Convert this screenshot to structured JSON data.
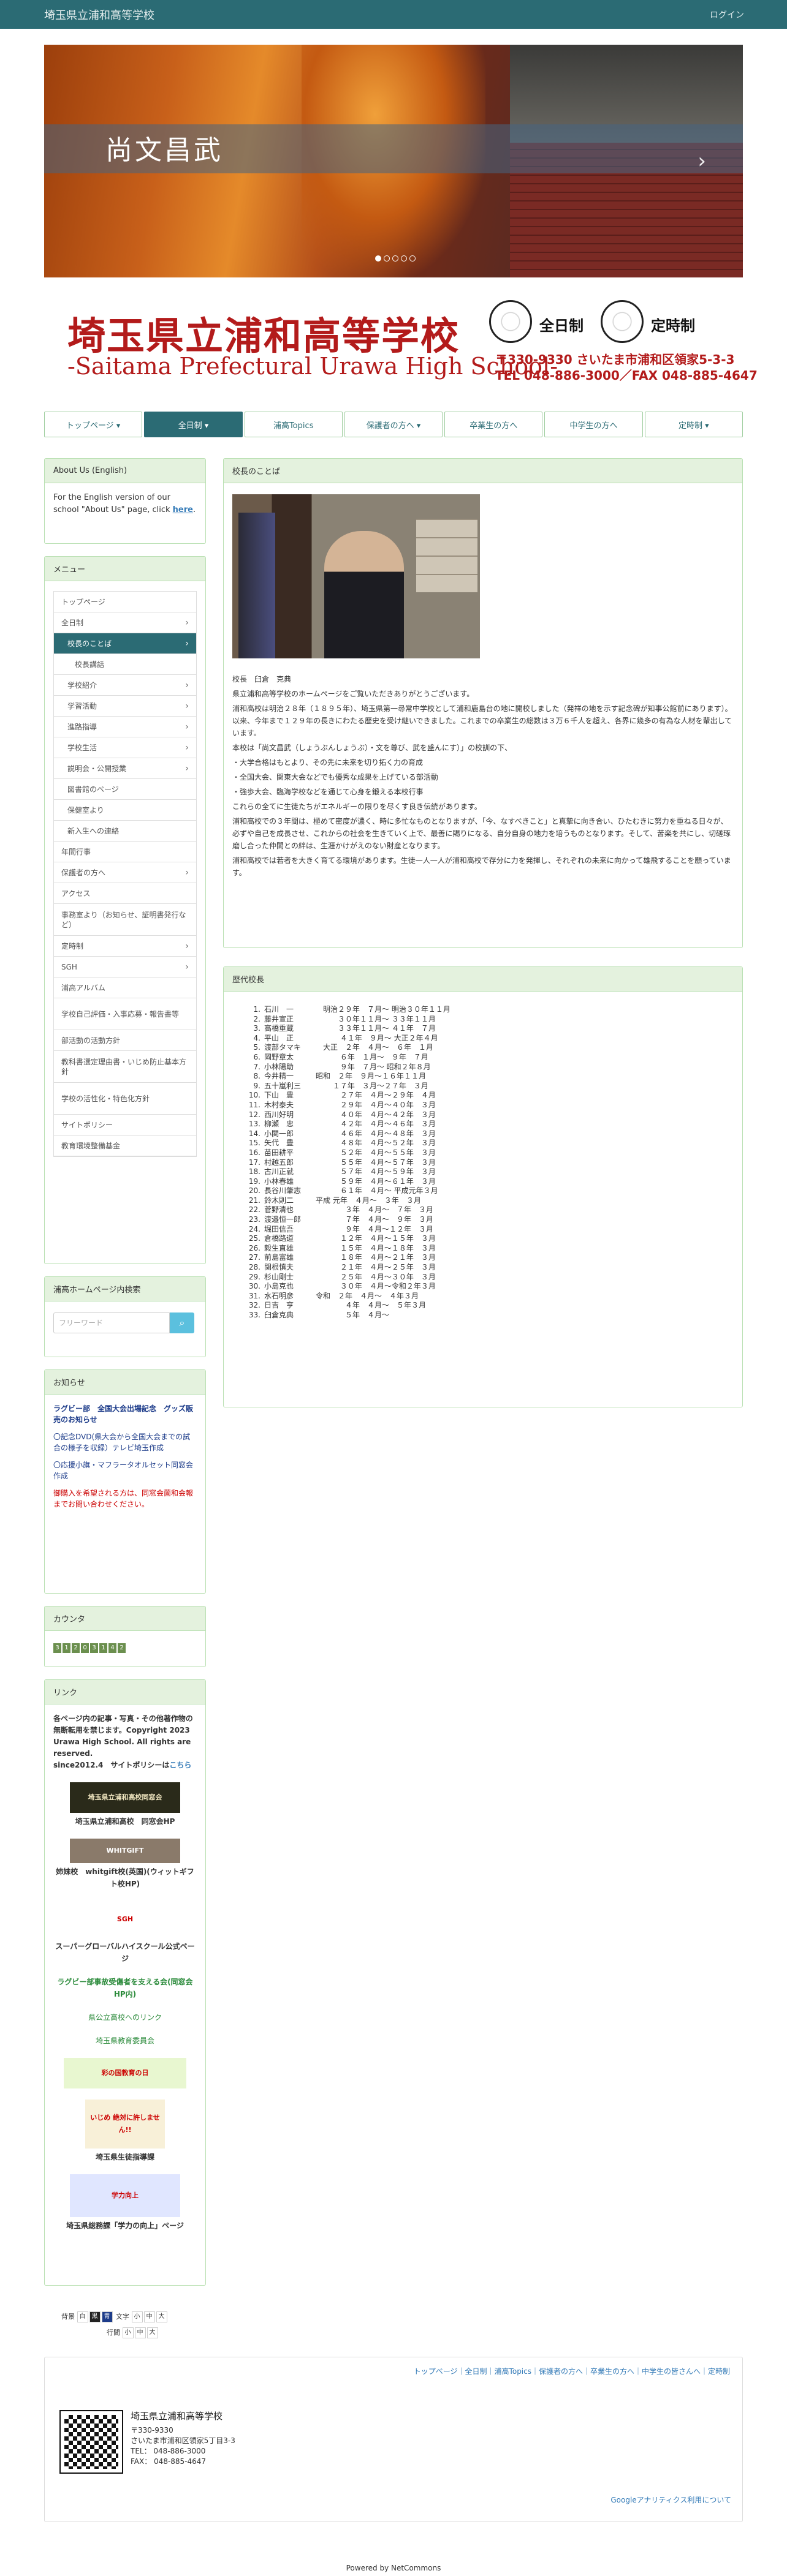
{
  "header": {
    "site_name": "埼玉県立浦和高等学校",
    "login": "ログイン"
  },
  "slider": {
    "caption": "尚文昌武",
    "next": "›",
    "dots": 5
  },
  "banner": {
    "title_jp": "埼玉県立浦和高等学校",
    "title_en": "-Saitama Prefectural Urawa High School-",
    "seal1": "全日制",
    "seal2": "定時制",
    "address": "〒330-9330 さいたま市浦和区領家5-3-3",
    "tel": "TEL 048-886-3000／FAX 048-885-4647"
  },
  "nav": [
    {
      "label": "トップページ ▾",
      "active": false
    },
    {
      "label": "全日制 ▾",
      "active": true
    },
    {
      "label": "浦高Topics",
      "active": false
    },
    {
      "label": "保護者の方へ ▾",
      "active": false
    },
    {
      "label": "卒業生の方へ",
      "active": false
    },
    {
      "label": "中学生の方へ",
      "active": false
    },
    {
      "label": "定時制 ▾",
      "active": false
    }
  ],
  "about": {
    "title": "About Us (English)",
    "text": "For the English version of our school \"About Us\" page, click ",
    "link": "here",
    "dot": "."
  },
  "menu": {
    "title": "メニュー",
    "items": [
      {
        "label": "トップページ",
        "level": 0,
        "chev": false,
        "active": false
      },
      {
        "label": "全日制",
        "level": 0,
        "chev": true,
        "active": false
      },
      {
        "label": "校長のことば",
        "level": 1,
        "chev": true,
        "active": true
      },
      {
        "label": "校長講話",
        "level": 2,
        "chev": false,
        "active": false
      },
      {
        "label": "学校紹介",
        "level": 1,
        "chev": true,
        "active": false
      },
      {
        "label": "学習活動",
        "level": 1,
        "chev": true,
        "active": false
      },
      {
        "label": "進路指導",
        "level": 1,
        "chev": true,
        "active": false
      },
      {
        "label": "学校生活",
        "level": 1,
        "chev": true,
        "active": false
      },
      {
        "label": "説明会・公開授業",
        "level": 1,
        "chev": true,
        "active": false
      },
      {
        "label": "図書館のページ",
        "level": 1,
        "chev": false,
        "active": false
      },
      {
        "label": "保健室より",
        "level": 1,
        "chev": false,
        "active": false
      },
      {
        "label": "新入生への連絡",
        "level": 1,
        "chev": false,
        "active": false
      },
      {
        "label": "年間行事",
        "level": 0,
        "chev": false,
        "active": false
      },
      {
        "label": "保護者の方へ",
        "level": 0,
        "chev": true,
        "active": false
      },
      {
        "label": "アクセス",
        "level": 0,
        "chev": false,
        "active": false
      },
      {
        "label": "事務室より（お知らせ、証明書発行など）",
        "level": 0,
        "chev": false,
        "active": false,
        "tall": true
      },
      {
        "label": "定時制",
        "level": 0,
        "chev": true,
        "active": false
      },
      {
        "label": "SGH",
        "level": 0,
        "chev": true,
        "active": false
      },
      {
        "label": "浦高アルバム",
        "level": 0,
        "chev": false,
        "active": false
      },
      {
        "label": "学校自己評価・入事応募・報告書等",
        "level": 0,
        "chev": false,
        "active": false,
        "tall": true
      },
      {
        "label": "部活動の活動方針",
        "level": 0,
        "chev": false,
        "active": false
      },
      {
        "label": "教科書選定理由書・いじめ防止基本方針",
        "level": 0,
        "chev": false,
        "active": false,
        "tall": true
      },
      {
        "label": "学校の活性化・特色化方針",
        "level": 0,
        "chev": false,
        "active": false,
        "tall": true
      },
      {
        "label": "サイトポリシー",
        "level": 0,
        "chev": false,
        "active": false
      },
      {
        "label": "教育環境整備基金",
        "level": 0,
        "chev": false,
        "active": false
      }
    ]
  },
  "search": {
    "title": "浦高ホームページ内検索",
    "placeholder": "フリーワード",
    "icon": "⌕"
  },
  "news": {
    "title": "お知らせ",
    "items": [
      {
        "text": "ラグビー部　全国大会出場記念　グッズ販売のお知らせ",
        "style": "blue-bold"
      },
      {
        "text": "〇記念DVD(県大会から全国大会までの試合の様子を収録）テレビ埼玉作成",
        "style": "blue"
      },
      {
        "text": "〇応援小旗・マフラータオルセット同窓会作成",
        "style": "blue"
      },
      {
        "text": "御購入を希望される方は、同窓会薗和会報までお問い合わせください。",
        "style": "red"
      }
    ]
  },
  "counter": {
    "title": "カウンタ",
    "digits": [
      "3",
      "1",
      "2",
      "0",
      "3",
      "1",
      "4",
      "2"
    ]
  },
  "links": {
    "title": "リンク",
    "copyright": "各ページ内の記事・写真・その他著作物の無断転用を禁じます。Copyright 2023 Urawa High School. All rights are reserved.",
    "since": "since2012.4　サイトポリシーは",
    "since_link": "こちら",
    "items": [
      {
        "img": "埼玉県立浦和高校同窓会",
        "label": "埼玉県立浦和高校　同窓会HP"
      },
      {
        "img": "WHITGIFT",
        "label": "姉妹校　whitgift校(英国)(ウィットギフト校HP)"
      },
      {
        "img": "SGH",
        "label": "スーパーグローバルハイスクール公式ページ"
      },
      {
        "img": "",
        "label": "ラグビー部事故受傷者を支える会(同窓会HP内)"
      },
      {
        "img": "",
        "label": "県公立高校へのリンク"
      },
      {
        "img": "",
        "label": "埼玉県教育委員会"
      },
      {
        "img": "彩の国教育の日",
        "label": ""
      },
      {
        "img": "いじめ 絶対に許しません!!",
        "label": "埼玉県生徒指導課"
      },
      {
        "img": "学力向上",
        "label": "埼玉県総務課「学力の向上」ページ"
      }
    ]
  },
  "principal": {
    "title": "校長のことば",
    "name": "校長　臼倉　克典",
    "paragraphs": [
      "県立浦和高等学校のホームページをご覧いただきありがとうございます。",
      "浦和高校は明治２８年（１８９５年）、埼玉県第一尋常中学校として浦和鹿島台の地に開校しました（発祥の地を示す記念碑が知事公館前にあります）。以来、今年まで１２９年の長きにわたる歴史を受け継いできました。これまでの卒業生の総数は３万６千人を超え、各界に幾多の有為な人材を輩出しています。",
      "本校は「尚文昌武（しょうぶんしょうぶ）・文を尊び、武を盛んにす）」の校訓の下、",
      "・大学合格はもとより、その先に未来を切り拓く力の育成",
      "・全国大会、関東大会などでも優秀な成果を上げている部活動",
      "・強歩大会、臨海学校などを通じて心身を鍛える本校行事",
      "これらの全てに生徒たちがエネルギーの限りを尽くす良き伝統があります。",
      "浦和高校での３年間は、極めて密度が濃く、時に多忙なものとなりますが、「今、なすべきこと」と真摯に向き合い、ひたむきに努力を重ねる日々が、必ずや自己を成長させ、これからの社会を生きていく上で、最善に賜りになる、自分自身の地力を培うものとなります。そして、苦楽を共にし、切磋琢磨し合った仲間との絆は、生涯かけがえのない財産となります。",
      "浦和高校では若者を大きく育てる環境があります。生徒一人一人が浦和高校で存分に力を発揮し、それぞれの未来に向かって雄飛することを願っています。"
    ]
  },
  "history": {
    "title": "歴代校長",
    "rows": [
      [
        "1.",
        "石川　一　　　　明治２９年　７月～ 明治３０年１１月"
      ],
      [
        "2.",
        "藤井宣正　　　　　　３０年１１月～ ３３年１１月"
      ],
      [
        "3.",
        "高橋重蔵　　　　　　３３年１１月～ ４１年　７月"
      ],
      [
        "4.",
        "平山　正　　　　　　 ４１年　９月～ 大正２年４月"
      ],
      [
        "5.",
        "渡部タマキ　　　大正　２年　４月～　６年　１月"
      ],
      [
        "6.",
        "岡野章太　　　　　　 ６年　１月～　９年　７月"
      ],
      [
        "7.",
        "小林陽助　　　　　　 ９年　７月～ 昭和２年８月"
      ],
      [
        "8.",
        "今井精一　　　昭和　２年　９月～１６年１１月"
      ],
      [
        "9.",
        "五十嵐利三　　　　 １７年　３月～２７年　３月"
      ],
      [
        "10.",
        "下山　豊　　　　　　 ２７年　４月～２９年　４月"
      ],
      [
        "11.",
        "木村泰夫　　　　　　 ２９年　４月～４０年　３月"
      ],
      [
        "12.",
        "西川好明　　　　　　 ４０年　４月～４２年　３月"
      ],
      [
        "13.",
        "柳瀬　忠　　　　　　 ４２年　４月～４６年　３月"
      ],
      [
        "14.",
        "小関一郎　　　　　　 ４６年　４月～４８年　３月"
      ],
      [
        "15.",
        "矢代　豊　　　　　　 ４８年　４月～５２年　３月"
      ],
      [
        "16.",
        "苗田耕平　　　　　　 ５２年　４月～５５年　３月"
      ],
      [
        "17.",
        "村越五郎　　　　　　 ５５年　４月～５７年　３月"
      ],
      [
        "18.",
        "古川正就　　　　　　 ５７年　４月～５９年　３月"
      ],
      [
        "19.",
        "小林春雄　　　　　　 ５９年　４月～６１年　３月"
      ],
      [
        "20.",
        "長谷川肇志　　　　　 ６１年　４月～ 平成元年３月"
      ],
      [
        "21.",
        "鈴木則二　　　平成 元年　４月～　３年　３月"
      ],
      [
        "22.",
        "菅野清也　　　　　　　３年　４月～　７年　３月"
      ],
      [
        "23.",
        "渡邉恒一郎　　　　　　７年　４月～　９年　３月"
      ],
      [
        "24.",
        "堀田信吾　　　　　　　９年　４月～１２年　３月"
      ],
      [
        "25.",
        "倉橋路道　　　　　　 １２年　４月～１５年　３月"
      ],
      [
        "26.",
        "毅生直雄　　　　　　 １５年　４月～１８年　３月"
      ],
      [
        "27.",
        "前島富雄　　　　　　 １８年　４月～２１年　３月"
      ],
      [
        "28.",
        "関根慎夫　　　　　　 ２１年　４月～２５年　３月"
      ],
      [
        "29.",
        "杉山剛士　　　　　　 ２５年　４月～３０年　３月"
      ],
      [
        "30.",
        "小島克也　　　　　　 ３０年　４月～令和２年３月"
      ],
      [
        "31.",
        "水石明彦　　　令和　２年　４月～　４年３月"
      ],
      [
        "32.",
        "日吉　亨　　　　　　　４年　４月～　５年３月"
      ],
      [
        "33.",
        "臼倉克典　　　　　　　５年　４月～"
      ]
    ]
  },
  "font_controls": {
    "bg_label": "背景",
    "bg_opts": [
      "白",
      "黒",
      "青"
    ],
    "text_label": "文字",
    "text_opts": [
      "小",
      "中",
      "大"
    ],
    "line_label": "行間",
    "line_opts": [
      "小",
      "中",
      "大"
    ]
  },
  "footer": {
    "nav": "トップページ｜全日制｜浦高Topics｜保護者の方へ｜卒業生の方へ｜中学生の皆さんへ｜定時制",
    "name": "埼玉県立浦和高等学校",
    "postal": "〒330-9330",
    "address": "さいたま市浦和区領家5丁目3-3",
    "tel": "TEL： 048-886-3000",
    "fax": "FAX： 048-885-4647",
    "ga": "Googleアナリティクス利用について"
  },
  "powered": "Powered by NetCommons"
}
